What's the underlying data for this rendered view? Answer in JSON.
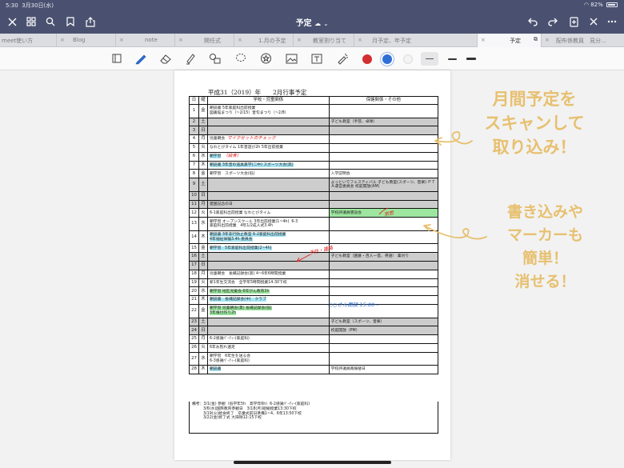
{
  "status": {
    "time": "5:30",
    "date": "3月30日(水)",
    "battery": "82%"
  },
  "nav": {
    "title": "予定"
  },
  "tabs": [
    {
      "label": "meet使い方"
    },
    {
      "label": "Blog"
    },
    {
      "label": "note"
    },
    {
      "label": "開任式"
    },
    {
      "label": "1.月の予定"
    },
    {
      "label": "教室割り当て"
    },
    {
      "label": "月予定、年予定"
    },
    {
      "label": "予定"
    },
    {
      "label": "配布係教員　見分…"
    }
  ],
  "colors": {
    "accent": "#4a5170",
    "pen_red": "#d32f2f",
    "pen_blue": "#2f6fd6",
    "hand_orange": "#e7c070"
  },
  "doc": {
    "title": "平成31（2019）年　　2月行事予定",
    "headers": {
      "day": "日",
      "weekday": "曜",
      "school": "学校・児童関係",
      "health": "保健関係・その他"
    },
    "rows": [
      {
        "d": "1",
        "w": "金",
        "s": "朝読書 5年家庭科出前授業\n図書館まつり（~2/15）音句まつり（~2/8）",
        "h": "",
        "gray": false
      },
      {
        "d": "2",
        "w": "土",
        "s": "",
        "h": "子ども教室（手芸、卓球）",
        "gray": true
      },
      {
        "d": "3",
        "w": "日",
        "s": "",
        "h": "",
        "gray": true
      },
      {
        "d": "4",
        "w": "月",
        "s": "児童朝会",
        "s_note": "マイクセットのチェック",
        "h": "",
        "gray": false
      },
      {
        "d": "5",
        "w": "火",
        "s": "なわとびタイム 1年音遊び2h 5年出前授業",
        "h": "",
        "gray": false
      },
      {
        "d": "6",
        "w": "水",
        "s": "朝学習",
        "s_note": "（給食）",
        "h": "",
        "gray": false
      },
      {
        "d": "7",
        "w": "木",
        "s": "朝読書 3年音の道具美学(二中) スポーツ大会(高)",
        "h": "",
        "gray": false
      },
      {
        "d": "8",
        "w": "金",
        "s": "朝学習　スポーツ大会(低)",
        "h": "入学説明会",
        "gray": false
      },
      {
        "d": "9",
        "w": "土",
        "s": "",
        "h": "よっといでフェスティバル 子ども教室(スポーツ、音楽) ＰＴＡ運営委員会 校庭開放(AM)",
        "gray": true
      },
      {
        "d": "10",
        "w": "日",
        "s": "",
        "h": "",
        "gray": true
      },
      {
        "d": "11",
        "w": "月",
        "s": "建国記念の日",
        "h": "",
        "gray": true
      },
      {
        "d": "12",
        "w": "火",
        "s": "6-1家庭科出前授業 なわとびタイム",
        "h": "学校評議員懇談会",
        "gray": false
      },
      {
        "d": "13",
        "w": "水",
        "s": "朝学習 オープンスクール 3年出前授業(1~4h)  6-3\n家庭科出前授業　4年1/2成人式3.4h",
        "h": "",
        "gray": false
      },
      {
        "d": "14",
        "w": "木",
        "s": "朝読書 3年非行防止教室 6-2家庭科出前授業\n4年福祉体験3.4h 委員会",
        "h": "",
        "gray": false
      },
      {
        "d": "15",
        "w": "金",
        "s": "朝学習　5年家庭科出前授業(2~4h)",
        "h": "",
        "gray": false
      },
      {
        "d": "16",
        "w": "土",
        "s": "",
        "h": "子ども教室（囲碁・百人一首、英語） 薬刈り",
        "gray": true
      },
      {
        "d": "17",
        "w": "日",
        "s": "",
        "h": "",
        "gray": true
      },
      {
        "d": "18",
        "w": "月",
        "s": "児童朝会　長縄記録会(高) 4~6年6時間授業",
        "h": "",
        "gray": false
      },
      {
        "d": "19",
        "w": "火",
        "s": "新1年生交流会　全学年5時間授業14:30下校",
        "h": "",
        "gray": false
      },
      {
        "d": "20",
        "w": "水",
        "s": "朝学習 地区児童会 6年がん教育3h",
        "h": "",
        "gray": false
      },
      {
        "d": "21",
        "w": "木",
        "s": "朝読書　長縄記録会(中)　クラブ",
        "h": "",
        "gray": false
      },
      {
        "d": "22",
        "w": "金",
        "s": "朝学習 児童朝会(夏) 長縄記録会(低)\n3年根付作り2h",
        "h": "",
        "gray": false
      },
      {
        "d": "23",
        "w": "土",
        "s": "",
        "h": "子ども教室（スポーツ、音楽）",
        "gray": true
      },
      {
        "d": "24",
        "w": "日",
        "s": "",
        "h": "校庭開放（PM）",
        "gray": true
      },
      {
        "d": "25",
        "w": "月",
        "s": "6-2感謝ﾊﾟｰﾃｨｰ(家庭科)",
        "h": "",
        "gray": false
      },
      {
        "d": "26",
        "w": "火",
        "s": "6年お別れ遠足",
        "h": "",
        "gray": false
      },
      {
        "d": "27",
        "w": "水",
        "s": "朝学習　6年生を送る会\n6-3感謝ﾊﾟｰﾃｨｰ(家庭科)",
        "h": "",
        "gray": false
      },
      {
        "d": "28",
        "w": "木",
        "s": "朝読書",
        "h": "学校評議員再振替日",
        "gray": false
      }
    ],
    "footnote": [
      "備考：3/1(金) 参観（低学年5h　高学年6h）6-2感謝ﾊﾟｰﾃｨｰ(家庭科)",
      "3/6(水)国際教育参観日　3/18(月)短縮授業13:30下校",
      "3/19(火)給食終了　卒業式前日準備1~4、6年13:50下校",
      "3/22(金)修了式 大掃除12:15下校"
    ],
    "red_notes": [
      "マイクセットのチェック",
      "（給食）",
      "宗哲",
      "予防・連絡"
    ],
    "blue_note": "○○さん面談 15:00~"
  },
  "handwriting": {
    "note1": [
      "月間予定を",
      "スキャンして",
      "取り込み！"
    ],
    "note2": [
      "書き込みや",
      "マーカーも",
      "簡単！",
      "消せる！"
    ]
  }
}
